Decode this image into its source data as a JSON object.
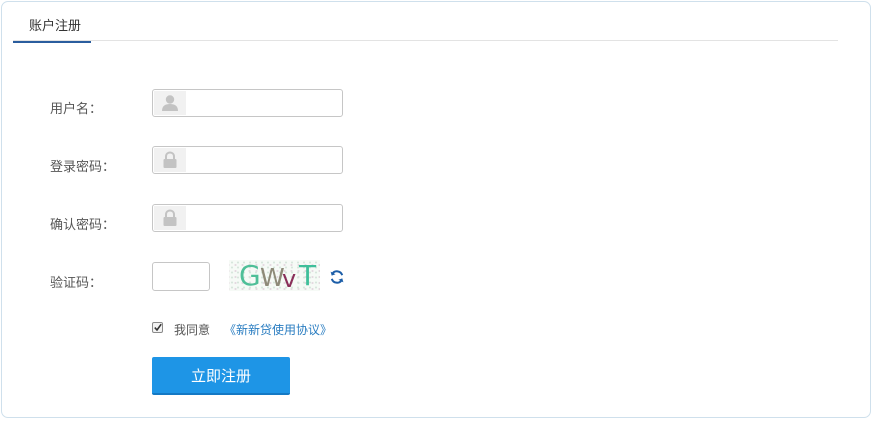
{
  "tab": {
    "label": "账户注册"
  },
  "form": {
    "username_label": "用户名：",
    "password_label": "登录密码：",
    "confirm_label": "确认密码：",
    "captcha_label": "验证码：",
    "username_value": "",
    "password_value": "",
    "confirm_value": "",
    "captcha_value": "",
    "username_icon": "user-icon",
    "password_icon": "lock-icon",
    "confirm_icon": "lock-icon"
  },
  "captcha": {
    "image_chars": [
      "G",
      "W",
      "v",
      "T"
    ],
    "refresh_icon": "refresh-icon"
  },
  "agreement": {
    "checked": true,
    "text": "我同意",
    "link": "《新新贷使用协议》"
  },
  "submit": {
    "label": "立即注册"
  },
  "colors": {
    "accent": "#1e95e6",
    "tab_underline": "#2a5d9e",
    "link": "#2a7dc1"
  }
}
